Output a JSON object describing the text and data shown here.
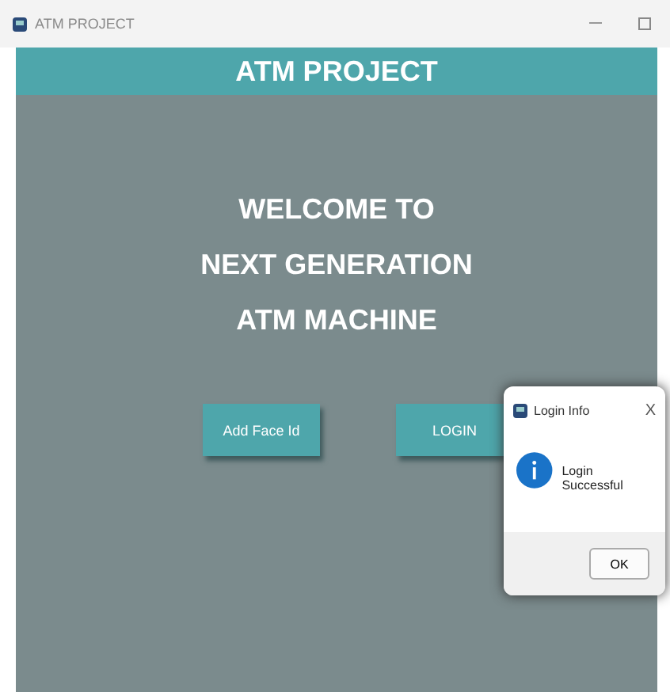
{
  "window": {
    "title": "ATM PROJECT"
  },
  "header": {
    "title": "ATM PROJECT"
  },
  "welcome": [
    "WELCOME TO",
    "NEXT GENERATION",
    "ATM MACHINE"
  ],
  "buttons": [
    {
      "label": "Add Face Id"
    },
    {
      "label": "LOGIN"
    }
  ],
  "dialog": {
    "title": "Login Info",
    "close": "X",
    "message": "Login Successful",
    "button": "OK"
  }
}
